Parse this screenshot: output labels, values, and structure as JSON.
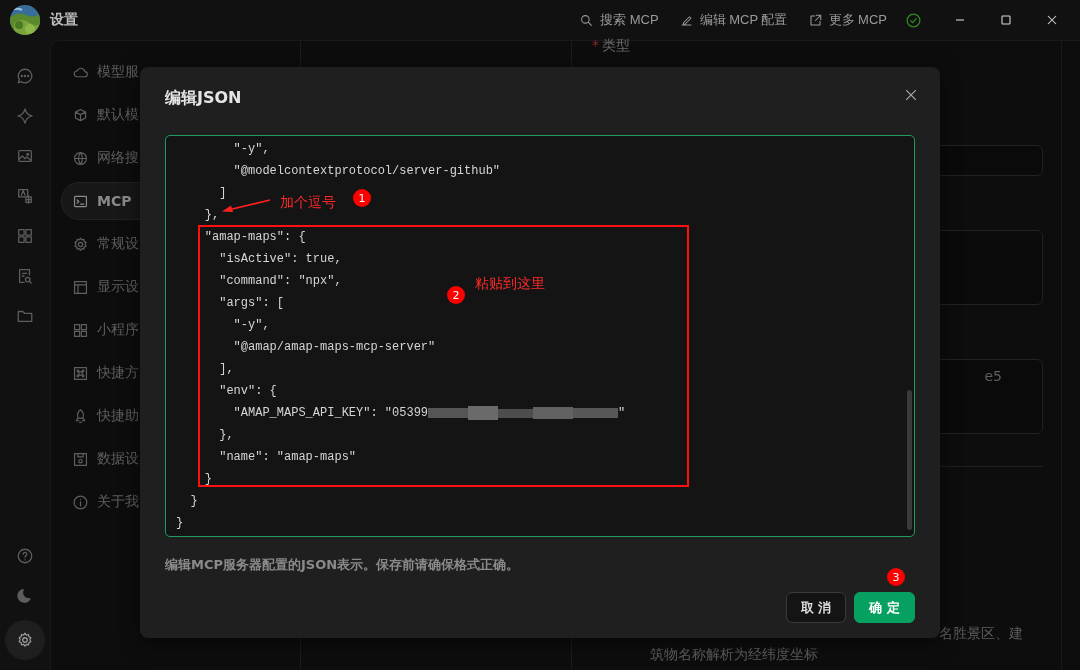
{
  "window": {
    "title": "设置"
  },
  "toolbar": [
    {
      "label": "搜索 MCP"
    },
    {
      "label": "编辑 MCP 配置"
    },
    {
      "label": "更多 MCP"
    }
  ],
  "status": {
    "ok": true
  },
  "rail": [
    {
      "selected": false
    },
    {
      "selected": false
    },
    {
      "selected": false
    },
    {
      "selected": false
    },
    {
      "selected": false
    },
    {
      "selected": false
    },
    {
      "selected": false
    }
  ],
  "rail_bottom": [
    {
      "selected": false
    },
    {
      "selected": false
    },
    {
      "selected": true
    }
  ],
  "nav": [
    {
      "label": "模型服",
      "selected": false
    },
    {
      "label": "默认模",
      "selected": false
    },
    {
      "label": "网络搜",
      "selected": false
    },
    {
      "label": "MCP",
      "selected": true
    },
    {
      "label": "常规设",
      "selected": false
    },
    {
      "label": "显示设",
      "selected": false
    },
    {
      "label": "小程序",
      "selected": false
    },
    {
      "label": "快捷方",
      "selected": false
    },
    {
      "label": "快捷助",
      "selected": false
    },
    {
      "label": "数据设",
      "selected": false
    },
    {
      "label": "关于我",
      "selected": false
    }
  ],
  "form": {
    "required_mark": "*",
    "type_label": "类型",
    "fields": [
      {
        "kind": "input"
      },
      {
        "kind": "textarea"
      },
      {
        "kind": "textarea",
        "value": "e5"
      }
    ],
    "description_line1": "名胜景区、建",
    "description_line2": "筑物名称解析为经纬度坐标"
  },
  "dialog": {
    "title": "编辑JSON",
    "lines": [
      {
        "text": "        \"-y\","
      },
      {
        "text": "        \"@modelcontextprotocol/server-github\""
      },
      {
        "text": "      ]"
      },
      {
        "text": "    },"
      },
      {
        "text": "    \"amap-maps\": {"
      },
      {
        "text": "      \"isActive\": true,"
      },
      {
        "text": "      \"command\": \"npx\","
      },
      {
        "text": "      \"args\": ["
      },
      {
        "text": "        \"-y\","
      },
      {
        "text": "        \"@amap/amap-maps-mcp-server\""
      },
      {
        "text": "      ],"
      },
      {
        "text": "      \"env\": {"
      },
      {
        "text": "        \"AMAP_MAPS_API_KEY\": \"05399",
        "redacted": true,
        "after": "\""
      },
      {
        "text": "      },"
      },
      {
        "text": "      \"name\": \"amap-maps\""
      },
      {
        "text": "    }"
      },
      {
        "text": "  }"
      },
      {
        "text": "}"
      }
    ],
    "hint": "编辑MCP服务器配置的JSON表示。保存前请确保格式正确。",
    "buttons": [
      {
        "label": "取 消",
        "kind": "secondary"
      },
      {
        "label": "确 定",
        "kind": "primary"
      }
    ]
  },
  "annotations": [
    {
      "kind": "arrow-note",
      "text": "加个逗号",
      "number": "1"
    },
    {
      "kind": "box-note",
      "text": "粘贴到这里",
      "number": "2"
    },
    {
      "kind": "badge",
      "number": "3"
    }
  ]
}
